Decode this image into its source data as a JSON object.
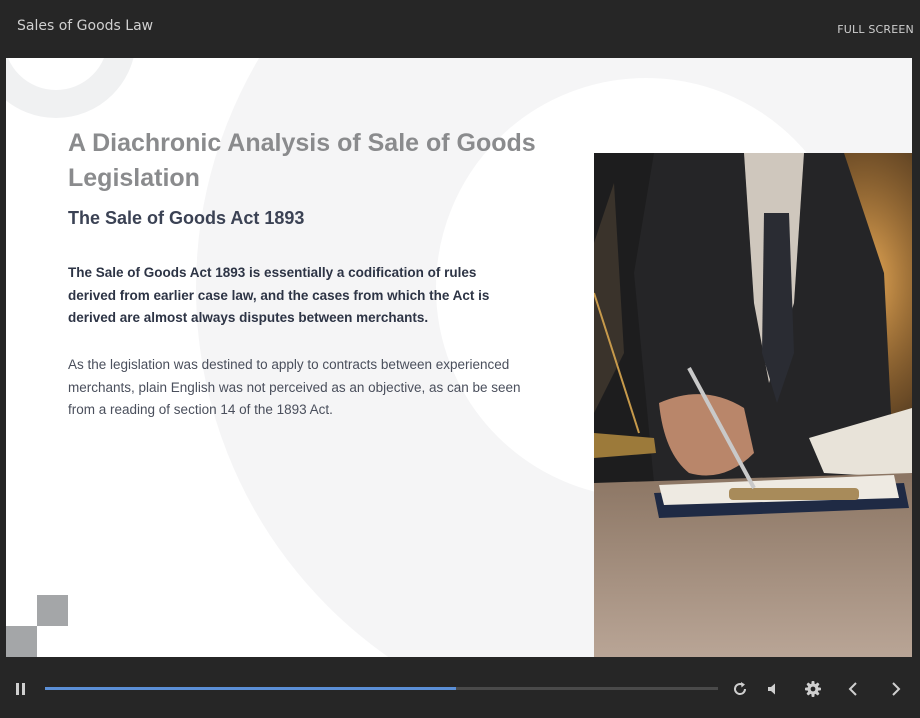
{
  "app": {
    "course_title": "Sales of Goods Law",
    "fullscreen_label": "FULL SCREEN"
  },
  "slide": {
    "title": "A Diachronic Analysis of Sale of Goods Legislation",
    "subtitle": "The Sale of Goods Act 1893",
    "paragraph_bold": "The Sale of Goods Act 1893 is essentially a codification of rules derived from earlier case law, and the cases from which the Act is derived are almost always disputes between merchants.",
    "paragraph": "As the legislation was destined to apply to contracts between experienced merchants, plain English was not perceived as an objective, as can be seen from a reading of section 14 of the 1893 Act.",
    "image_icon": "businessman-signing-document-photo"
  },
  "player": {
    "progress_fraction": 0.61,
    "icons": [
      "pause-icon",
      "replay-icon",
      "volume-icon",
      "settings-icon",
      "previous-icon",
      "next-icon"
    ],
    "accent_color": "#5b8fd6"
  }
}
